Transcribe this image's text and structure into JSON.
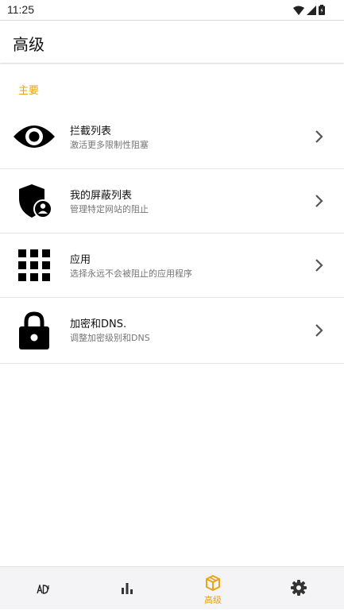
{
  "status_bar": {
    "time": "11:25"
  },
  "header": {
    "title": "高级"
  },
  "section": {
    "label": "主要"
  },
  "items": [
    {
      "title": "拦截列表",
      "subtitle": "激活更多限制性阻塞",
      "icon": "eye-icon"
    },
    {
      "title": "我的屏蔽列表",
      "subtitle": "管理特定网站的阻止",
      "icon": "shield-user-icon"
    },
    {
      "title": "应用",
      "subtitle": "选择永远不会被阻止的应用程序",
      "icon": "apps-grid-icon"
    },
    {
      "title": "加密和DNS.",
      "subtitle": "调整加密级别和DNS",
      "icon": "lock-icon"
    }
  ],
  "bottom_nav": {
    "items": [
      {
        "icon": "ad-block-icon",
        "label": ""
      },
      {
        "icon": "bar-chart-icon",
        "label": ""
      },
      {
        "icon": "cube-icon",
        "label": "高级",
        "active": true
      },
      {
        "icon": "gear-icon",
        "label": ""
      }
    ],
    "accent_color": "#E8A317"
  },
  "colors": {
    "accent": "#E8A317",
    "subtitle": "#757575"
  }
}
